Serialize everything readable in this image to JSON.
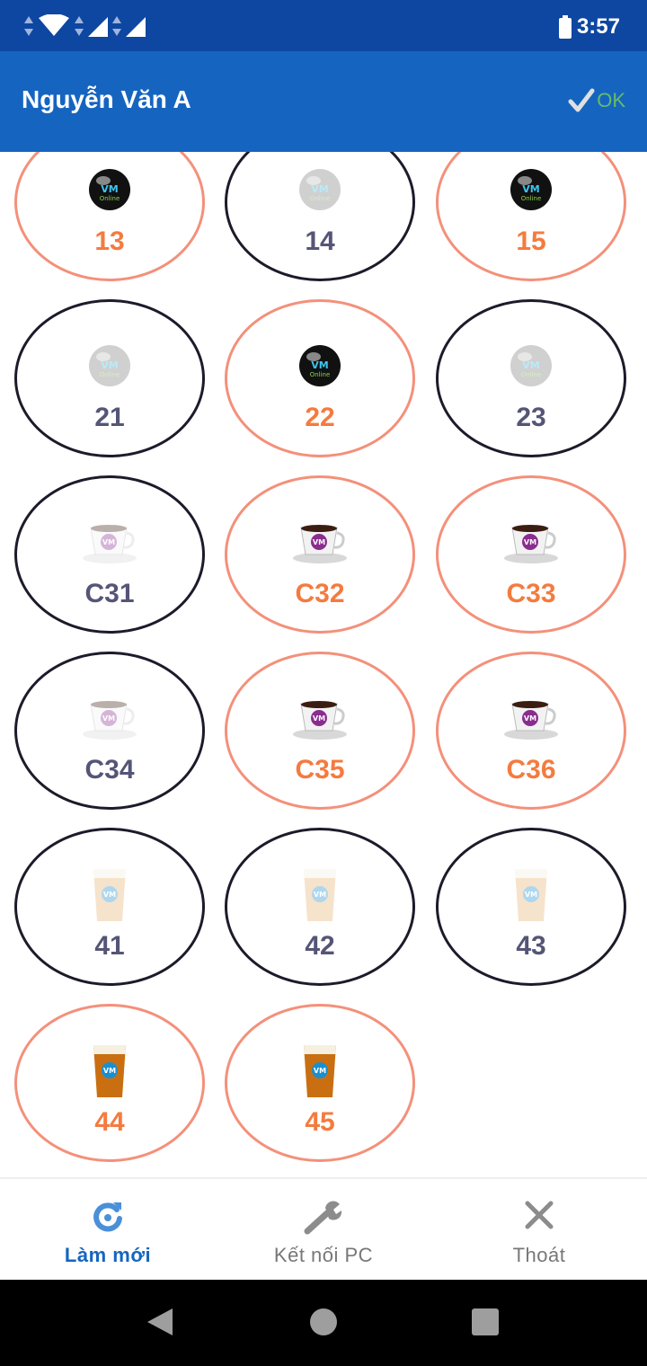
{
  "status_bar": {
    "time": "3:57",
    "icons": [
      "data-arrows-icon",
      "wifi-icon",
      "data-arrows-icon",
      "signal-icon",
      "data-arrows-icon",
      "signal-icon",
      "battery-icon"
    ]
  },
  "app_bar": {
    "title": "Nguyễn Văn A",
    "ok_label": "OK"
  },
  "tables": [
    {
      "label": "13",
      "type": "billiard",
      "active": true
    },
    {
      "label": "14",
      "type": "billiard",
      "active": false
    },
    {
      "label": "15",
      "type": "billiard",
      "active": true
    },
    {
      "label": "21",
      "type": "billiard",
      "active": false
    },
    {
      "label": "22",
      "type": "billiard",
      "active": true
    },
    {
      "label": "23",
      "type": "billiard",
      "active": false
    },
    {
      "label": "C31",
      "type": "coffee",
      "active": false
    },
    {
      "label": "C32",
      "type": "coffee",
      "active": true
    },
    {
      "label": "C33",
      "type": "coffee",
      "active": true
    },
    {
      "label": "C34",
      "type": "coffee",
      "active": false
    },
    {
      "label": "C35",
      "type": "coffee",
      "active": true
    },
    {
      "label": "C36",
      "type": "coffee",
      "active": true
    },
    {
      "label": "41",
      "type": "beer",
      "active": false
    },
    {
      "label": "42",
      "type": "beer",
      "active": false
    },
    {
      "label": "43",
      "type": "beer",
      "active": false
    },
    {
      "label": "44",
      "type": "beer",
      "active": true
    },
    {
      "label": "45",
      "type": "beer",
      "active": true
    }
  ],
  "bottom_nav": {
    "refresh_label": "Làm mới",
    "connect_label": "Kết nối PC",
    "exit_label": "Thoát"
  },
  "colors": {
    "status_bar": "#0d47a1",
    "app_bar": "#1565c0",
    "active_border": "#f4907a",
    "active_text": "#f47b3f",
    "inactive_border": "#1b1b2b",
    "inactive_text": "#555577",
    "ok_green": "#66bb6a"
  }
}
